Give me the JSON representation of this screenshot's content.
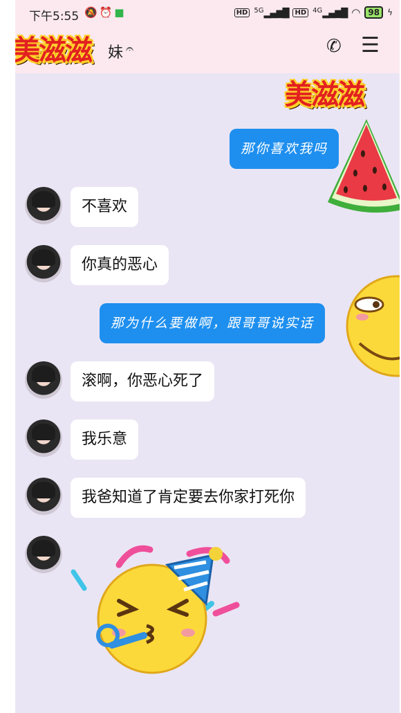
{
  "status_bar": {
    "time": "下午5:55",
    "hd1": "HD",
    "net1": "5G",
    "hd2": "HD",
    "net2": "4G",
    "battery": "98"
  },
  "header": {
    "title": "妹",
    "ear_icon": "ear-icon",
    "call_icon": "phone-icon",
    "menu_icon": "menu-icon",
    "sticker_text": "美滋滋"
  },
  "messages": [
    {
      "side": "out",
      "text": "那你喜欢我吗"
    },
    {
      "side": "in",
      "text": "不喜欢"
    },
    {
      "side": "in",
      "text": "你真的恶心"
    },
    {
      "side": "out",
      "text": "那为什么要做啊，跟哥哥说实话"
    },
    {
      "side": "in",
      "text": "滚啊，你恶心死了"
    },
    {
      "side": "in",
      "text": "我乐意"
    },
    {
      "side": "in",
      "text": "我爸知道了肯定要去你家打死你"
    }
  ],
  "stickers": {
    "top_right_text": "美滋滋",
    "watermelon": "watermelon-sticker",
    "emoji_peek": "smirk-emoji-sticker",
    "party_emoji": "party-emoji-sticker"
  },
  "colors": {
    "background": "#eae5f4",
    "header": "#fbe9ef",
    "outgoing": "#1e8fef",
    "incoming": "#ffffff"
  }
}
